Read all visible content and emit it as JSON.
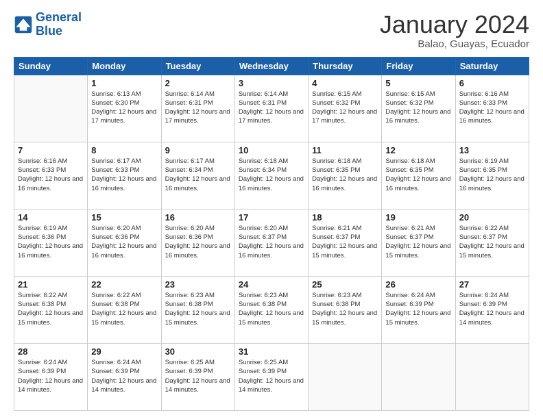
{
  "header": {
    "logo_line1": "General",
    "logo_line2": "Blue",
    "month_title": "January 2024",
    "location": "Balao, Guayas, Ecuador"
  },
  "weekdays": [
    "Sunday",
    "Monday",
    "Tuesday",
    "Wednesday",
    "Thursday",
    "Friday",
    "Saturday"
  ],
  "weeks": [
    [
      {
        "day": "",
        "sunrise": "",
        "sunset": "",
        "daylight": ""
      },
      {
        "day": "1",
        "sunrise": "6:13 AM",
        "sunset": "6:30 PM",
        "daylight": "12 hours and 17 minutes."
      },
      {
        "day": "2",
        "sunrise": "6:14 AM",
        "sunset": "6:31 PM",
        "daylight": "12 hours and 17 minutes."
      },
      {
        "day": "3",
        "sunrise": "6:14 AM",
        "sunset": "6:31 PM",
        "daylight": "12 hours and 17 minutes."
      },
      {
        "day": "4",
        "sunrise": "6:15 AM",
        "sunset": "6:32 PM",
        "daylight": "12 hours and 17 minutes."
      },
      {
        "day": "5",
        "sunrise": "6:15 AM",
        "sunset": "6:32 PM",
        "daylight": "12 hours and 16 minutes."
      },
      {
        "day": "6",
        "sunrise": "6:16 AM",
        "sunset": "6:33 PM",
        "daylight": "12 hours and 16 minutes."
      }
    ],
    [
      {
        "day": "7",
        "sunrise": "6:16 AM",
        "sunset": "6:33 PM",
        "daylight": "12 hours and 16 minutes."
      },
      {
        "day": "8",
        "sunrise": "6:17 AM",
        "sunset": "6:33 PM",
        "daylight": "12 hours and 16 minutes."
      },
      {
        "day": "9",
        "sunrise": "6:17 AM",
        "sunset": "6:34 PM",
        "daylight": "12 hours and 16 minutes."
      },
      {
        "day": "10",
        "sunrise": "6:18 AM",
        "sunset": "6:34 PM",
        "daylight": "12 hours and 16 minutes."
      },
      {
        "day": "11",
        "sunrise": "6:18 AM",
        "sunset": "6:35 PM",
        "daylight": "12 hours and 16 minutes."
      },
      {
        "day": "12",
        "sunrise": "6:18 AM",
        "sunset": "6:35 PM",
        "daylight": "12 hours and 16 minutes."
      },
      {
        "day": "13",
        "sunrise": "6:19 AM",
        "sunset": "6:35 PM",
        "daylight": "12 hours and 16 minutes."
      }
    ],
    [
      {
        "day": "14",
        "sunrise": "6:19 AM",
        "sunset": "6:36 PM",
        "daylight": "12 hours and 16 minutes."
      },
      {
        "day": "15",
        "sunrise": "6:20 AM",
        "sunset": "6:36 PM",
        "daylight": "12 hours and 16 minutes."
      },
      {
        "day": "16",
        "sunrise": "6:20 AM",
        "sunset": "6:36 PM",
        "daylight": "12 hours and 16 minutes."
      },
      {
        "day": "17",
        "sunrise": "6:20 AM",
        "sunset": "6:37 PM",
        "daylight": "12 hours and 16 minutes."
      },
      {
        "day": "18",
        "sunrise": "6:21 AM",
        "sunset": "6:37 PM",
        "daylight": "12 hours and 15 minutes."
      },
      {
        "day": "19",
        "sunrise": "6:21 AM",
        "sunset": "6:37 PM",
        "daylight": "12 hours and 15 minutes."
      },
      {
        "day": "20",
        "sunrise": "6:22 AM",
        "sunset": "6:37 PM",
        "daylight": "12 hours and 15 minutes."
      }
    ],
    [
      {
        "day": "21",
        "sunrise": "6:22 AM",
        "sunset": "6:38 PM",
        "daylight": "12 hours and 15 minutes."
      },
      {
        "day": "22",
        "sunrise": "6:22 AM",
        "sunset": "6:38 PM",
        "daylight": "12 hours and 15 minutes."
      },
      {
        "day": "23",
        "sunrise": "6:23 AM",
        "sunset": "6:38 PM",
        "daylight": "12 hours and 15 minutes."
      },
      {
        "day": "24",
        "sunrise": "6:23 AM",
        "sunset": "6:38 PM",
        "daylight": "12 hours and 15 minutes."
      },
      {
        "day": "25",
        "sunrise": "6:23 AM",
        "sunset": "6:38 PM",
        "daylight": "12 hours and 15 minutes."
      },
      {
        "day": "26",
        "sunrise": "6:24 AM",
        "sunset": "6:39 PM",
        "daylight": "12 hours and 15 minutes."
      },
      {
        "day": "27",
        "sunrise": "6:24 AM",
        "sunset": "6:39 PM",
        "daylight": "12 hours and 14 minutes."
      }
    ],
    [
      {
        "day": "28",
        "sunrise": "6:24 AM",
        "sunset": "6:39 PM",
        "daylight": "12 hours and 14 minutes."
      },
      {
        "day": "29",
        "sunrise": "6:24 AM",
        "sunset": "6:39 PM",
        "daylight": "12 hours and 14 minutes."
      },
      {
        "day": "30",
        "sunrise": "6:25 AM",
        "sunset": "6:39 PM",
        "daylight": "12 hours and 14 minutes."
      },
      {
        "day": "31",
        "sunrise": "6:25 AM",
        "sunset": "6:39 PM",
        "daylight": "12 hours and 14 minutes."
      },
      {
        "day": "",
        "sunrise": "",
        "sunset": "",
        "daylight": ""
      },
      {
        "day": "",
        "sunrise": "",
        "sunset": "",
        "daylight": ""
      },
      {
        "day": "",
        "sunrise": "",
        "sunset": "",
        "daylight": ""
      }
    ]
  ]
}
